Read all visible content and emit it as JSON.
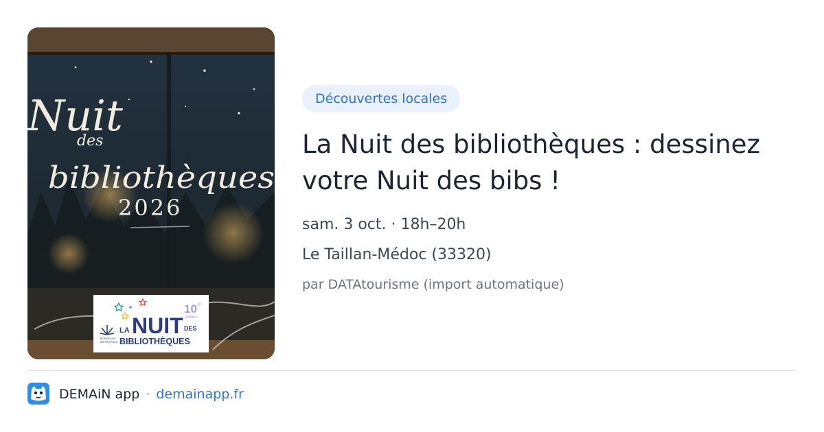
{
  "card": {
    "image": {
      "script_line1": "Nuit",
      "script_line2": "des",
      "script_line3": "bibliothèques",
      "year": "2026",
      "logo": {
        "la": "LA",
        "nuit": "NUIT",
        "des": "DES",
        "bibliotheques": "BIBLIOTHÈQUES",
        "edition_number": "10",
        "edition_suffix": "e",
        "edition_label": "édition",
        "org_line1": "BORDEAUX",
        "org_line2": "MÉTROPOLE"
      }
    },
    "category": "Découvertes locales",
    "title": "La Nuit des bibliothèques : dessinez votre Nuit des bibs !",
    "datetime": "sam. 3 oct. · 18h–20h",
    "location": "Le Taillan-Médoc (33320)",
    "source": "par DATAtourisme (import automatique)"
  },
  "footer": {
    "app_name": "DEMAiN app",
    "separator": "·",
    "domain": "demainapp.fr"
  },
  "colors": {
    "chip_background": "#e8f1fc",
    "accent": "#3373c9",
    "title": "#1b2430",
    "app_logo": "#2f8fe6"
  },
  "icons": [
    "demain-app-logo-icon"
  ]
}
